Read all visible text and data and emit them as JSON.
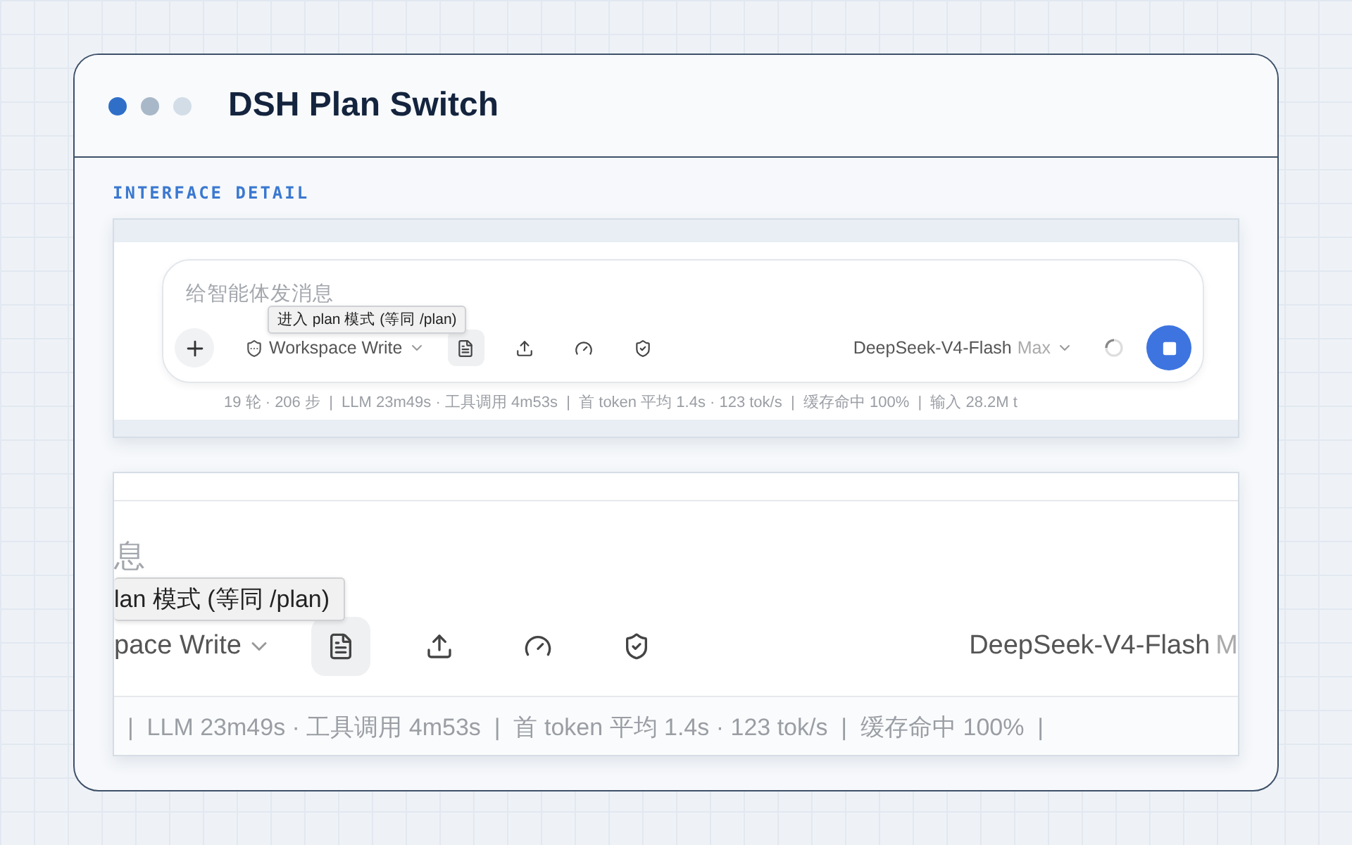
{
  "window": {
    "title": "DSH Plan Switch",
    "dots": [
      {
        "color": "#2f6fc8"
      },
      {
        "color": "#a9b8c8"
      },
      {
        "color": "#d3dde7"
      }
    ]
  },
  "section_label": "INTERFACE DETAIL",
  "overview": {
    "placeholder": "给智能体发消息",
    "tooltip": "进入 plan 模式 (等同 /plan)",
    "mode": "Workspace Write",
    "tools": [
      {
        "kind": "plan",
        "selected": true
      },
      {
        "kind": "upload",
        "selected": false
      },
      {
        "kind": "gauge",
        "selected": false
      },
      {
        "kind": "shield",
        "selected": false
      }
    ],
    "model": "DeepSeek-V4-Flash",
    "variant": "Max",
    "busy": true,
    "stats": "19 轮 · 206 步  |  LLM 23m49s · 工具调用 4m53s  |  首 token 平均 1.4s · 123 tok/s  |  缓存命中 100%  |  输入 28.2M t"
  },
  "detail": {
    "placeholder": "息",
    "tooltip": "lan 模式 (等同 /plan)",
    "mode": "pace Write",
    "tools": [
      {
        "kind": "plan",
        "selected": true
      },
      {
        "kind": "upload",
        "selected": false
      },
      {
        "kind": "gauge",
        "selected": false
      },
      {
        "kind": "shield",
        "selected": false
      }
    ],
    "model": "DeepSeek-V4-Flash",
    "variant": "M",
    "stats": "  |  LLM 23m49s · 工具调用 4m53s  |  首 token 平均 1.4s · 123 tok/s  |  缓存命中 100%  |"
  }
}
